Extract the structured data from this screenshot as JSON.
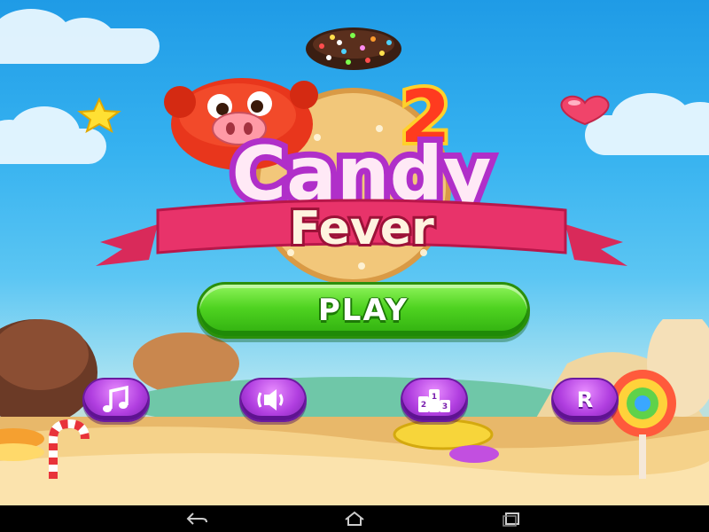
{
  "game": {
    "title_number": "2",
    "title_word_1": "Candy",
    "title_word_2": "Fever",
    "play_label": "PLAY",
    "rate_label": "R",
    "leaderboard_digits": [
      "1",
      "2",
      "3"
    ]
  },
  "icons": {
    "music": "music-note-icon",
    "sound": "speaker-icon",
    "leaderboard": "podium-icon",
    "rate": "letter-r-icon",
    "nav_back": "back-arrow-icon",
    "nav_home": "home-icon",
    "nav_recents": "recents-icon"
  },
  "colors": {
    "sky": "#2fa8ec",
    "play_green": "#4fd321",
    "button_purple": "#b13fe0",
    "title_purple": "#b02fc9",
    "ribbon_red": "#e8336a"
  }
}
